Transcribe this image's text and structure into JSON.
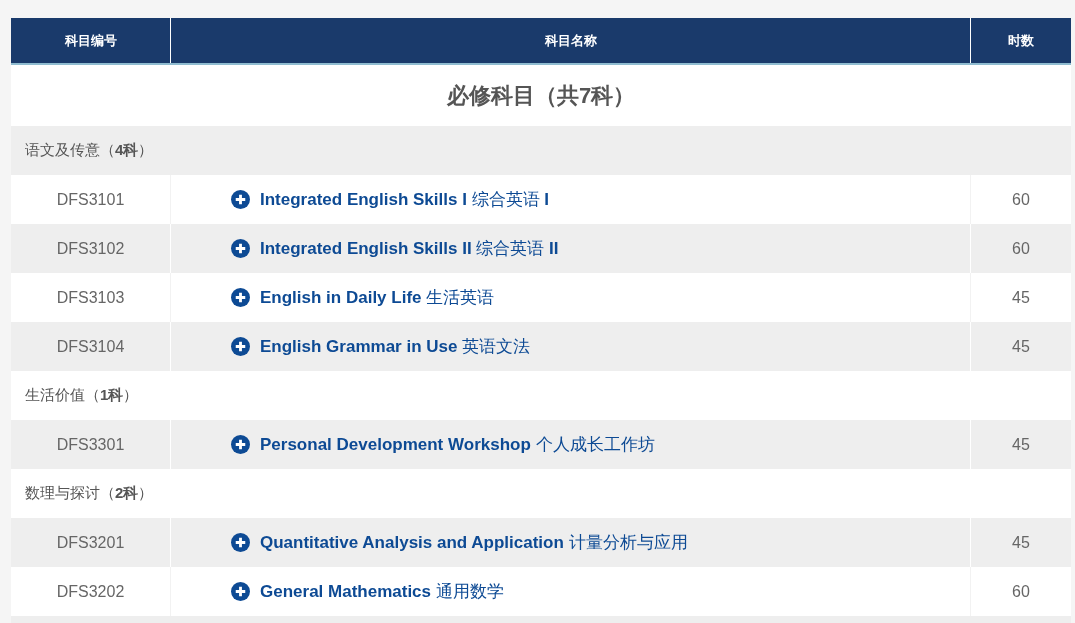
{
  "table": {
    "columns": [
      "科目编号",
      "科目名称",
      "时数"
    ],
    "title": "必修科目（共7科）",
    "groups": [
      {
        "label": "语文及传意（**4科**）",
        "rows": [
          {
            "code": "DFS3101",
            "name": "**Integrated English Skills I** 综合英语 **I**",
            "hours": "60"
          },
          {
            "code": "DFS3102",
            "name": "**Integrated English Skills II** 综合英语 **II**",
            "hours": "60"
          },
          {
            "code": "DFS3103",
            "name": "**English in Daily Life** 生活英语",
            "hours": "45"
          },
          {
            "code": "DFS3104",
            "name": "**English Grammar in Use** 英语文法",
            "hours": "45"
          }
        ]
      },
      {
        "label": "生活价值（**1科**）",
        "rows": [
          {
            "code": "DFS3301",
            "name": "**Personal Development Workshop** 个人成长工作坊",
            "hours": "45"
          }
        ]
      },
      {
        "label": "数理与探讨（**2科**）",
        "rows": [
          {
            "code": "DFS3201",
            "name": "**Quantitative Analysis and Application** 计量分析与应用",
            "hours": "45"
          },
          {
            "code": "DFS3202",
            "name": "**General Mathematics** 通用数学",
            "hours": "60"
          }
        ]
      }
    ]
  }
}
